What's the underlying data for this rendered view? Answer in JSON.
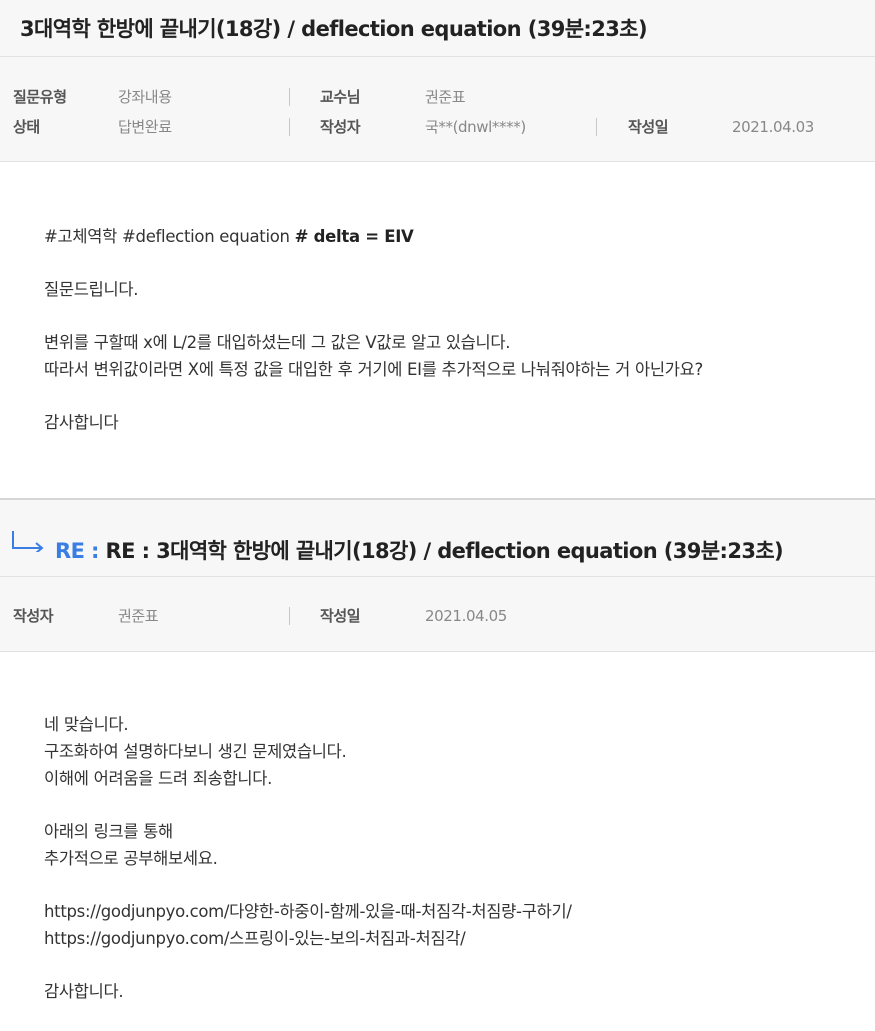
{
  "question": {
    "title": "3대역학 한방에 끝내기(18강) / deflection equation (39분:23초)",
    "meta": {
      "type_label": "질문유형",
      "type_value": "강좌내용",
      "professor_label": "교수님",
      "professor_value": "권준표",
      "status_label": "상태",
      "status_value": "답변완료",
      "author_label": "작성자",
      "author_value": "국**(dnwl****)",
      "date_label": "작성일",
      "date_value": "2021.04.03"
    },
    "body": {
      "tags_plain": "#고체역학 #deflection equation ",
      "tags_bold": "# delta = EIV",
      "line1": "질문드립니다.",
      "line2": "변위를 구할때 x에 L/2를 대입하셨는데 그 값은 V값로 알고 있습니다.",
      "line3": "따라서 변위값이라면 X에 특정 값을 대입한 후 거기에 EI를 추가적으로 나눠줘야하는 거 아닌가요?",
      "line4": "감사합니다"
    }
  },
  "reply": {
    "re_prefix": "RE :",
    "title": "RE : 3대역학 한방에 끝내기(18강) / deflection equation (39분:23초)",
    "meta": {
      "author_label": "작성자",
      "author_value": "권준표",
      "date_label": "작성일",
      "date_value": "2021.04.05"
    },
    "body": {
      "line1": "네 맞습니다.",
      "line2": "구조화하여 설명하다보니 생긴 문제였습니다.",
      "line3": "이해에 어려움을 드려 죄송합니다.",
      "line4": "아래의 링크를 통해",
      "line5": "추가적으로 공부해보세요.",
      "link1": "https://godjunpyo.com/다양한-하중이-함께-있을-때-처짐각-처짐량-구하기/",
      "link2": "https://godjunpyo.com/스프링이-있는-보의-처짐과-처짐각/",
      "line6": "감사합니다."
    }
  },
  "colors": {
    "accent": "#3a7de3",
    "header_bg": "#f7f7f7",
    "label": "#555555",
    "value": "#888888"
  },
  "icons": {
    "reply": "reply-arrow-icon"
  }
}
